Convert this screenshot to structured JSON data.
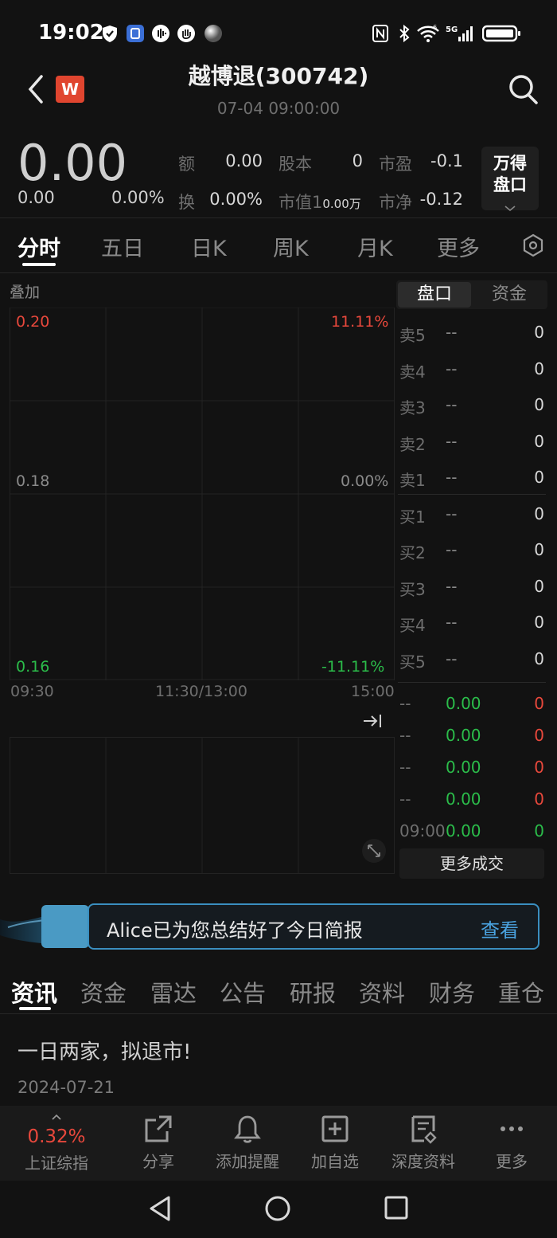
{
  "status": {
    "time": "19:02",
    "network": "5G"
  },
  "header": {
    "title": "越博退(300742)",
    "subtitle": "07-04 09:00:00",
    "logo_letter": "W"
  },
  "quote": {
    "price": "0.00",
    "change": "0.00",
    "change_pct": "0.00%",
    "amount_label": "额",
    "amount": "0.00",
    "share_label": "股本",
    "share": "0",
    "pe_label": "市盈",
    "pe": "-0.1",
    "turnover_label": "换",
    "turnover": "0.00%",
    "mcap_label": "市值",
    "mcap_prefix": "1",
    "mcap_value": "0.00万",
    "pb_label": "市净",
    "pb": "-0.12",
    "wande_line1": "万得",
    "wande_line2": "盘口"
  },
  "tabs": [
    "分时",
    "五日",
    "日K",
    "周K",
    "月K",
    "更多"
  ],
  "chart": {
    "overlay_label": "叠加",
    "price_high": "0.20",
    "price_mid": "0.18",
    "price_low": "0.16",
    "pct_high": "11.11%",
    "pct_mid": "0.00%",
    "pct_low": "-11.11%",
    "time_start": "09:30",
    "time_mid": "11:30/13:00",
    "time_end": "15:00"
  },
  "chart_data": {
    "type": "line",
    "title": "",
    "x": [
      "09:30",
      "11:30/13:00",
      "15:00"
    ],
    "series": [],
    "ylim": [
      0.16,
      0.2
    ],
    "y2lim": [
      "-11.11%",
      "11.11%"
    ],
    "grid": true
  },
  "orderbook": {
    "tab_active": "盘口",
    "tab_other": "资金",
    "asks": [
      {
        "label": "卖5",
        "price": "--",
        "vol": "0"
      },
      {
        "label": "卖4",
        "price": "--",
        "vol": "0"
      },
      {
        "label": "卖3",
        "price": "--",
        "vol": "0"
      },
      {
        "label": "卖2",
        "price": "--",
        "vol": "0"
      },
      {
        "label": "卖1",
        "price": "--",
        "vol": "0"
      }
    ],
    "bids": [
      {
        "label": "买1",
        "price": "--",
        "vol": "0"
      },
      {
        "label": "买2",
        "price": "--",
        "vol": "0"
      },
      {
        "label": "买3",
        "price": "--",
        "vol": "0"
      },
      {
        "label": "买4",
        "price": "--",
        "vol": "0"
      },
      {
        "label": "买5",
        "price": "--",
        "vol": "0"
      }
    ],
    "trades": [
      {
        "time": "--",
        "price": "0.00",
        "vol": "0",
        "color": "#e8483c"
      },
      {
        "time": "--",
        "price": "0.00",
        "vol": "0",
        "color": "#e8483c"
      },
      {
        "time": "--",
        "price": "0.00",
        "vol": "0",
        "color": "#e8483c"
      },
      {
        "time": "--",
        "price": "0.00",
        "vol": "0",
        "color": "#e8483c"
      },
      {
        "time": "09:00",
        "price": "0.00",
        "vol": "0",
        "color": "#2bbd4a"
      }
    ],
    "more_trades": "更多成交"
  },
  "banner": {
    "text": "Alice已为您总结好了今日简报",
    "link": "查看"
  },
  "news_tabs": [
    "资讯",
    "资金",
    "雷达",
    "公告",
    "研报",
    "资料",
    "财务",
    "重仓"
  ],
  "news": {
    "title": "一日两家，拟退市!",
    "date": "2024-07-21"
  },
  "bottombar": {
    "index_pct": "0.32%",
    "index_label": "上证综指",
    "share": "分享",
    "alert": "添加提醒",
    "watch": "加自选",
    "depth": "深度资料",
    "more": "更多"
  },
  "colors": {
    "up": "#e8483c",
    "down": "#2bbd4a",
    "accent": "#4aa3e0",
    "background": "#121212"
  }
}
